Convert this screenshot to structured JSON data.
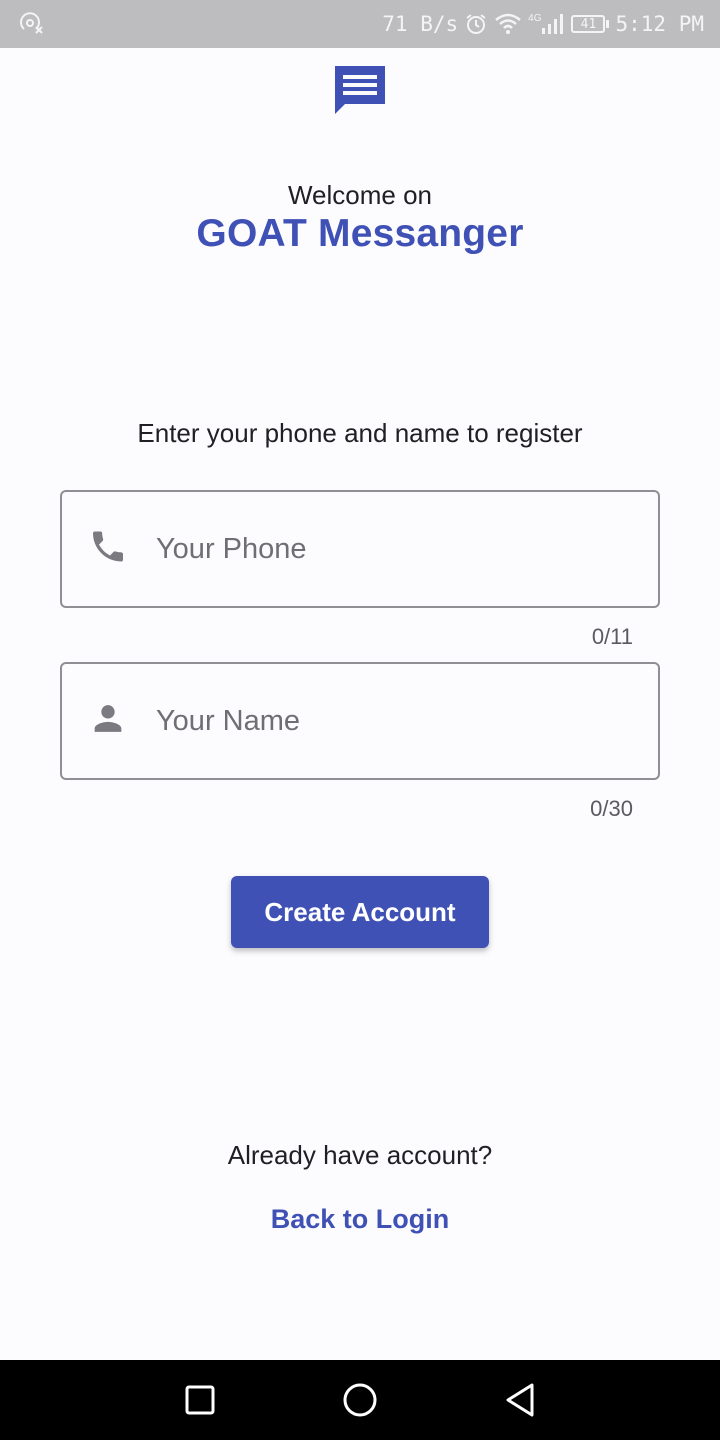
{
  "status_bar": {
    "network_speed": "71 B/s",
    "network_type": "4G",
    "battery": "41",
    "time": "5:12 PM",
    "icons": [
      "hotspot-icon",
      "alarm-icon",
      "wifi-icon",
      "signal-icon",
      "battery-icon"
    ]
  },
  "header": {
    "logo_icon": "chat-message-icon",
    "welcome": "Welcome on",
    "app_name": "GOAT Messanger"
  },
  "form": {
    "instruction": "Enter your phone and name to register",
    "phone": {
      "icon": "phone-icon",
      "placeholder": "Your Phone",
      "value": "",
      "counter": "0/11"
    },
    "name": {
      "icon": "person-icon",
      "placeholder": "Your Name",
      "value": "",
      "counter": "0/30"
    },
    "submit_label": "Create Account"
  },
  "footer": {
    "prompt": "Already have account?",
    "login_link": "Back to Login"
  },
  "nav_bar": {
    "buttons": [
      "recents-square-icon",
      "home-circle-icon",
      "back-triangle-icon"
    ]
  },
  "colors": {
    "accent": "#3f51b5",
    "background": "#fcfbfd",
    "status_bar": "#bdbcbf",
    "nav_bar": "#000000"
  }
}
